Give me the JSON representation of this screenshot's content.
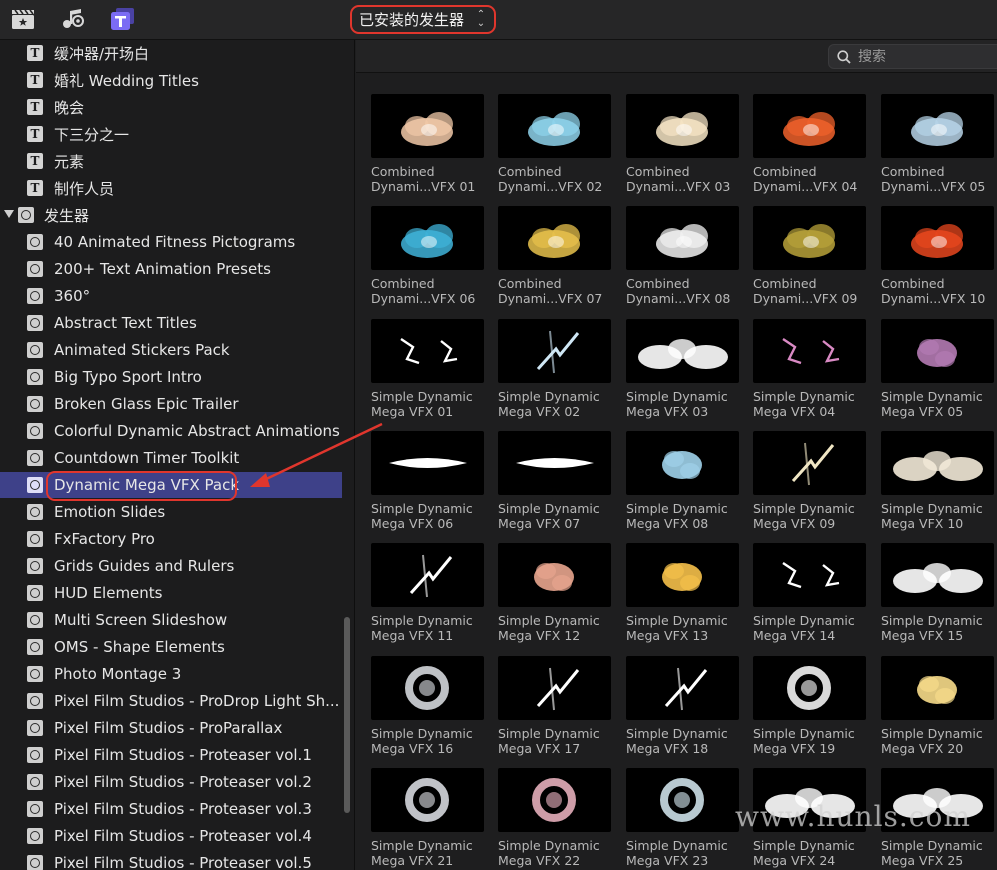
{
  "toolbar": {
    "icons": [
      "clapperboard-star-icon",
      "music-camera-icon",
      "titles-generators-icon"
    ],
    "library_dropdown": "已安装的发生器"
  },
  "search": {
    "placeholder": "搜索"
  },
  "sidebar": {
    "items": [
      {
        "label": "缓冲器/开场白",
        "type": "title"
      },
      {
        "label": "婚礼 Wedding Titles",
        "type": "title"
      },
      {
        "label": "晚会",
        "type": "title"
      },
      {
        "label": "下三分之一",
        "type": "title"
      },
      {
        "label": "元素",
        "type": "title"
      },
      {
        "label": "制作人员",
        "type": "title"
      },
      {
        "label": "发生器",
        "type": "group"
      },
      {
        "label": "40 Animated Fitness Pictograms",
        "type": "generator"
      },
      {
        "label": "200+ Text Animation Presets",
        "type": "generator"
      },
      {
        "label": "360°",
        "type": "generator"
      },
      {
        "label": "Abstract Text Titles",
        "type": "generator"
      },
      {
        "label": "Animated Stickers Pack",
        "type": "generator"
      },
      {
        "label": "Big Typo Sport Intro",
        "type": "generator"
      },
      {
        "label": "Broken Glass Epic Trailer",
        "type": "generator"
      },
      {
        "label": "Colorful Dynamic Abstract Animations",
        "type": "generator"
      },
      {
        "label": "Countdown Timer Toolkit",
        "type": "generator"
      },
      {
        "label": "Dynamic Mega VFX Pack",
        "type": "generator",
        "selected": true
      },
      {
        "label": "Emotion Slides",
        "type": "generator"
      },
      {
        "label": "FxFactory Pro",
        "type": "generator"
      },
      {
        "label": "Grids Guides and Rulers",
        "type": "generator"
      },
      {
        "label": "HUD Elements",
        "type": "generator"
      },
      {
        "label": "Multi Screen Slideshow",
        "type": "generator"
      },
      {
        "label": "OMS - Shape Elements",
        "type": "generator"
      },
      {
        "label": "Photo Montage 3",
        "type": "generator"
      },
      {
        "label": "Pixel Film Studios - ProDrop Light Sh...",
        "type": "generator"
      },
      {
        "label": "Pixel Film Studios - ProParallax",
        "type": "generator"
      },
      {
        "label": "Pixel Film Studios - Proteaser vol.1",
        "type": "generator"
      },
      {
        "label": "Pixel Film Studios - Proteaser vol.2",
        "type": "generator"
      },
      {
        "label": "Pixel Film Studios - Proteaser vol.3",
        "type": "generator"
      },
      {
        "label": "Pixel Film Studios - Proteaser vol.4",
        "type": "generator"
      },
      {
        "label": "Pixel Film Studios - Proteaser vol.5",
        "type": "generator"
      }
    ]
  },
  "grid": {
    "items": [
      {
        "line1": "Combined",
        "line2": "Dynami...VFX 01",
        "color": "#f2c9a8"
      },
      {
        "line1": "Combined",
        "line2": "Dynami...VFX 02",
        "color": "#8fd4ec"
      },
      {
        "line1": "Combined",
        "line2": "Dynami...VFX 03",
        "color": "#f7e6c6"
      },
      {
        "line1": "Combined",
        "line2": "Dynami...VFX 04",
        "color": "#f0612b"
      },
      {
        "line1": "Combined",
        "line2": "Dynami...VFX 05",
        "color": "#b7d4e8"
      },
      {
        "line1": "Combined",
        "line2": "Dynami...VFX 06",
        "color": "#3fb3d9"
      },
      {
        "line1": "Combined",
        "line2": "Dynami...VFX 07",
        "color": "#e8c24c"
      },
      {
        "line1": "Combined",
        "line2": "Dynami...VFX 08",
        "color": "#f2f2f2"
      },
      {
        "line1": "Combined",
        "line2": "Dynami...VFX 09",
        "color": "#b8a23a"
      },
      {
        "line1": "Combined",
        "line2": "Dynami...VFX 10",
        "color": "#e8471e"
      },
      {
        "line1": "Simple Dynamic",
        "line2": "Mega VFX 01",
        "color": "#ffffff"
      },
      {
        "line1": "Simple Dynamic",
        "line2": "Mega VFX 02",
        "color": "#cfe7f5"
      },
      {
        "line1": "Simple Dynamic",
        "line2": "Mega VFX 03",
        "color": "#ffffff"
      },
      {
        "line1": "Simple Dynamic",
        "line2": "Mega VFX 04",
        "color": "#d98ac4"
      },
      {
        "line1": "Simple Dynamic",
        "line2": "Mega VFX 05",
        "color": "#b47ab3"
      },
      {
        "line1": "Simple Dynamic",
        "line2": "Mega VFX 06",
        "color": "#ffffff"
      },
      {
        "line1": "Simple Dynamic",
        "line2": "Mega VFX 07",
        "color": "#ffffff"
      },
      {
        "line1": "Simple Dynamic",
        "line2": "Mega VFX 08",
        "color": "#9fd2ea"
      },
      {
        "line1": "Simple Dynamic",
        "line2": "Mega VFX 09",
        "color": "#f0e6c4"
      },
      {
        "line1": "Simple Dynamic",
        "line2": "Mega VFX 10",
        "color": "#f3ead8"
      },
      {
        "line1": "Simple Dynamic",
        "line2": "Mega VFX 11",
        "color": "#ffffff"
      },
      {
        "line1": "Simple Dynamic",
        "line2": "Mega VFX 12",
        "color": "#e8a58e"
      },
      {
        "line1": "Simple Dynamic",
        "line2": "Mega VFX 13",
        "color": "#f5c04a"
      },
      {
        "line1": "Simple Dynamic",
        "line2": "Mega VFX 14",
        "color": "#ffffff"
      },
      {
        "line1": "Simple Dynamic",
        "line2": "Mega VFX 15",
        "color": "#ffffff"
      },
      {
        "line1": "Simple Dynamic",
        "line2": "Mega VFX 16",
        "color": "#dfe3e8"
      },
      {
        "line1": "Simple Dynamic",
        "line2": "Mega VFX 17",
        "color": "#ffffff"
      },
      {
        "line1": "Simple Dynamic",
        "line2": "Mega VFX 18",
        "color": "#ffffff"
      },
      {
        "line1": "Simple Dynamic",
        "line2": "Mega VFX 19",
        "color": "#ffffff"
      },
      {
        "line1": "Simple Dynamic",
        "line2": "Mega VFX 20",
        "color": "#f7dc8a"
      },
      {
        "line1": "Simple Dynamic",
        "line2": "Mega VFX 21",
        "color": "#e2e4ea"
      },
      {
        "line1": "Simple Dynamic",
        "line2": "Mega VFX 22",
        "color": "#f2b8c6"
      },
      {
        "line1": "Simple Dynamic",
        "line2": "Mega VFX 23",
        "color": "#d8ecf5"
      },
      {
        "line1": "Simple Dynamic",
        "line2": "Mega VFX 24",
        "color": "#ffffff"
      },
      {
        "line1": "Simple Dynamic",
        "line2": "Mega VFX 25",
        "color": "#ffffff"
      }
    ]
  },
  "watermark": "www.hunls.com",
  "colors": {
    "accent_red": "#e0362d",
    "selection": "#3e4189"
  }
}
